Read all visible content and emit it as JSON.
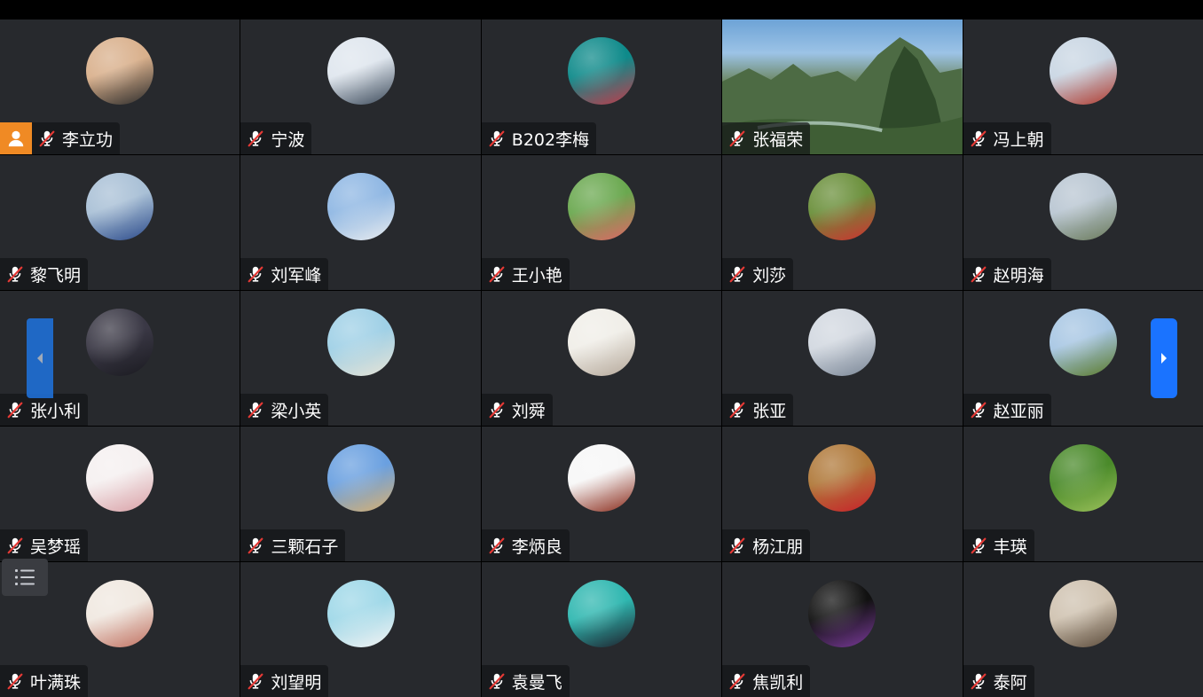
{
  "participants": [
    {
      "name": "李立功",
      "host": true,
      "avatar": [
        "#d9b08c",
        "#2a2a2a"
      ]
    },
    {
      "name": "宁波",
      "avatar": [
        "#dfe6ee",
        "#3c4a5a"
      ]
    },
    {
      "name": "B202李梅",
      "avatar": [
        "#0e8a8a",
        "#c23a4a"
      ]
    },
    {
      "name": "张福荣",
      "featured": true,
      "avatar": [
        "#6da3d6",
        "#2e4a2a"
      ]
    },
    {
      "name": "冯上朝",
      "avatar": [
        "#c9d6e3",
        "#b03a2e"
      ]
    },
    {
      "name": "黎飞明",
      "avatar": [
        "#a9c0d6",
        "#2b4a8a"
      ]
    },
    {
      "name": "刘军峰",
      "avatar": [
        "#8fb7e3",
        "#e9ecef"
      ]
    },
    {
      "name": "王小艳",
      "avatar": [
        "#6aa84f",
        "#e06666"
      ]
    },
    {
      "name": "刘莎",
      "avatar": [
        "#6a8f3a",
        "#d03030"
      ]
    },
    {
      "name": "赵明海",
      "avatar": [
        "#b9c6d2",
        "#6a7a5a"
      ]
    },
    {
      "name": "张小利",
      "avatar": [
        "#3a3845",
        "#1a1a20"
      ]
    },
    {
      "name": "梁小英",
      "avatar": [
        "#9fd0e6",
        "#e7e3d6"
      ]
    },
    {
      "name": "刘舜",
      "avatar": [
        "#f0eee8",
        "#b5a89a"
      ]
    },
    {
      "name": "张亚",
      "avatar": [
        "#d2d8e0",
        "#7a8696"
      ]
    },
    {
      "name": "赵亚丽",
      "avatar": [
        "#a7c6e3",
        "#5a7a2a"
      ]
    },
    {
      "name": "吴梦瑶",
      "avatar": [
        "#f5f0f0",
        "#d9a0a6"
      ]
    },
    {
      "name": "三颗石子",
      "avatar": [
        "#6aa0e0",
        "#d8b070"
      ]
    },
    {
      "name": "李炳良",
      "avatar": [
        "#f7f7f7",
        "#8a2a1a"
      ]
    },
    {
      "name": "杨江朋",
      "avatar": [
        "#b0793a",
        "#c8202a"
      ]
    },
    {
      "name": "丰瑛",
      "avatar": [
        "#4a8a2a",
        "#9ac05a"
      ]
    },
    {
      "name": "叶满珠",
      "avatar": [
        "#f0e8e0",
        "#c07060"
      ]
    },
    {
      "name": "刘望明",
      "avatar": [
        "#9fd8e8",
        "#f3f3f3"
      ]
    },
    {
      "name": "袁曼飞",
      "avatar": [
        "#2fb7b0",
        "#1e1e2a"
      ]
    },
    {
      "name": "焦凯利",
      "avatar": [
        "#111111",
        "#7a3a9a"
      ]
    },
    {
      "name": "泰阿",
      "avatar": [
        "#cfc2b0",
        "#5a4a3a"
      ]
    }
  ],
  "icons": {
    "mic_muted": "mic-muted-icon",
    "host": "host-icon",
    "nav_left": "chevron-left-icon",
    "nav_right": "chevron-right-icon",
    "list": "list-icon"
  },
  "colors": {
    "host_badge": "#f08a24",
    "nav_button": "#1a73ff",
    "tile_bg": "#27292d",
    "mute_red": "#e53935"
  }
}
